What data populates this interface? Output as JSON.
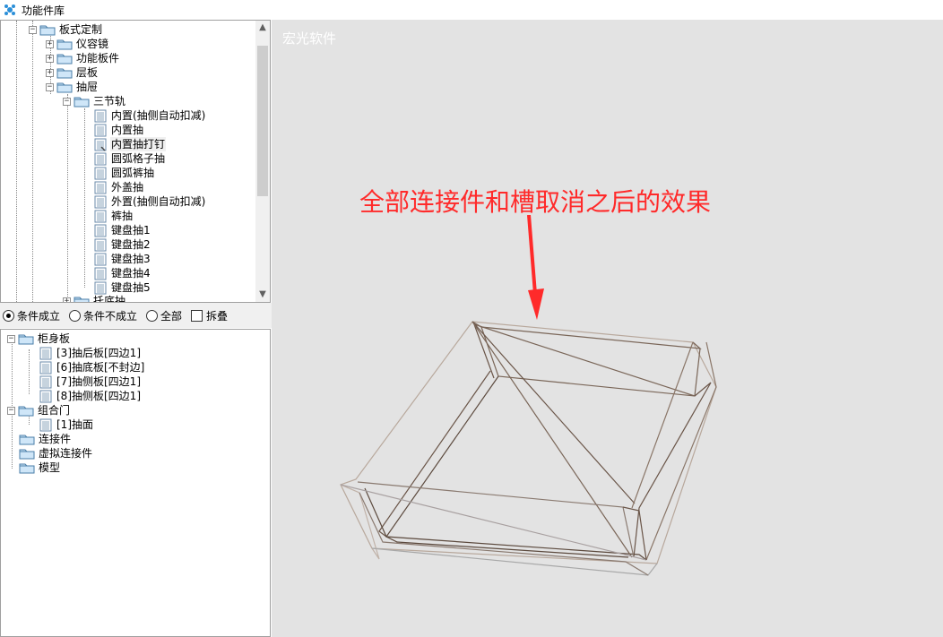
{
  "window": {
    "title": "功能件库"
  },
  "tree_top": {
    "nodes": {
      "n0": "板式定制",
      "n1": "仪容镜",
      "n2": "功能板件",
      "n3": "层板",
      "n4": "抽屉",
      "n5": "三节轨",
      "n6": "内置(抽侧自动扣减)",
      "n7": "内置抽",
      "n8": "内置抽打钉",
      "n9": "圆弧格子抽",
      "n10": "圆弧裤抽",
      "n11": "外盖抽",
      "n12": "外置(抽侧自动扣减)",
      "n13": "裤抽",
      "n14": "键盘抽1",
      "n15": "键盘抽2",
      "n16": "键盘抽3",
      "n17": "键盘抽4",
      "n18": "键盘抽5",
      "n19": "托底抽"
    },
    "expander_plus": "+",
    "expander_minus": "−"
  },
  "filter": {
    "opt1": "条件成立",
    "opt2": "条件不成立",
    "opt3": "全部",
    "fold": "拆叠",
    "selected": "条件成立"
  },
  "tree_bottom": {
    "n0": "柜身板",
    "n1": "[3]抽后板[四边1]",
    "n2": "[6]抽底板[不封边]",
    "n3": "[7]抽侧板[四边1]",
    "n4": "[8]抽侧板[四边1]",
    "n5": "组合门",
    "n6": "[1]抽面",
    "n7": "连接件",
    "n8": "虚拟连接件",
    "n9": "模型"
  },
  "viewport": {
    "watermark": "宏光软件",
    "annotation": "全部连接件和槽取消之后的效果",
    "annotation_color": "#ff2a2a",
    "background": "#e3e3e3"
  },
  "icons": {
    "app": "cube-app-icon",
    "folder": "folder-icon",
    "document": "document-icon",
    "arrow": "red-arrow-icon"
  }
}
